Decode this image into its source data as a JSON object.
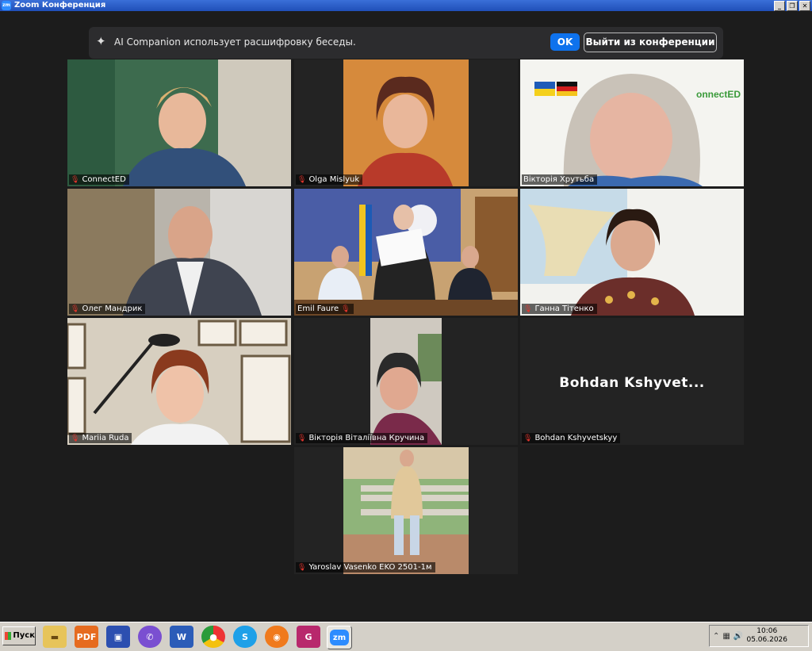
{
  "window": {
    "title": "Zoom Конференция",
    "app_icon": "zm"
  },
  "banner": {
    "message": "AI Companion использует расшифровку беседы.",
    "ok_label": "OK",
    "leave_label": "Выйти из конференции"
  },
  "participants": [
    {
      "name": "ConnectED"
    },
    {
      "name": "Olga Mislyuk"
    },
    {
      "name": "Вікторія Хрутьба"
    },
    {
      "name": "Олег Мандрик"
    },
    {
      "name": "Emil Faure"
    },
    {
      "name": "Ганна Тітенко"
    },
    {
      "name": "Mariia Ruda"
    },
    {
      "name": "Вікторія Віталіївна Кручина"
    },
    {
      "name": "Bohdan Kshyvetskyy",
      "placeholder_text": "Bohdan  Kshyvet..."
    },
    {
      "name": "Yaroslav Vasenko EKO 2501-1м"
    }
  ],
  "taskbar": {
    "start_label": "Пуск",
    "time": "10:06",
    "date": "05.06.2026",
    "icons": [
      "folder-icon",
      "pdf-icon",
      "save-icon",
      "viber-icon",
      "word-icon",
      "chrome-icon",
      "skype-icon",
      "firefox-icon",
      "pdf-editor-icon",
      "zoom-icon"
    ]
  },
  "colors": {
    "accent": "#0e72ed",
    "active_speaker": "#d8d06a",
    "mic_muted": "#e3352d"
  }
}
